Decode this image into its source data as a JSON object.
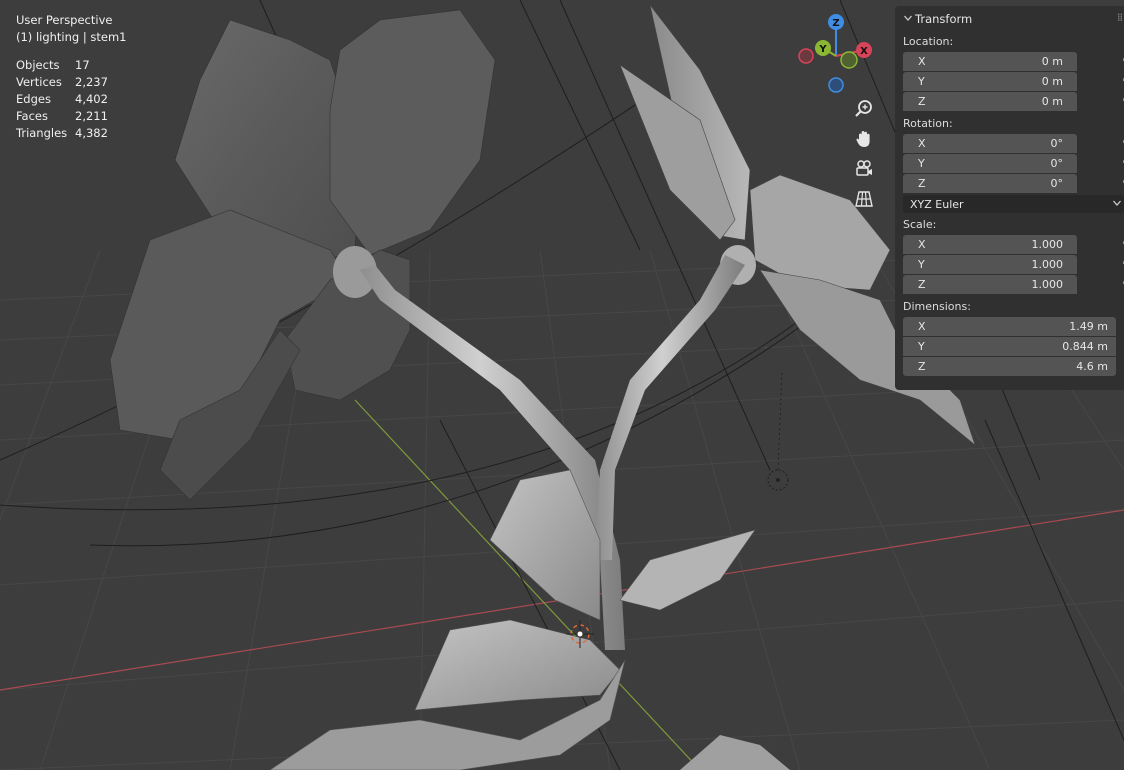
{
  "overlay": {
    "view_name": "User Perspective",
    "collection_object": "(1) lighting | stem1",
    "stats": [
      {
        "label": "Objects",
        "value": "17"
      },
      {
        "label": "Vertices",
        "value": "2,237"
      },
      {
        "label": "Edges",
        "value": "4,402"
      },
      {
        "label": "Faces",
        "value": "2,211"
      },
      {
        "label": "Triangles",
        "value": "4,382"
      }
    ]
  },
  "gizmo": {
    "z": "Z",
    "y": "Y",
    "x": "X"
  },
  "nav_buttons": [
    "zoom-icon",
    "hand-pan-icon",
    "camera-icon",
    "grid-ortho-icon"
  ],
  "panel": {
    "title": "Transform",
    "location": {
      "label": "Location:",
      "fields": [
        {
          "axis": "X",
          "value": "0 m"
        },
        {
          "axis": "Y",
          "value": "0 m"
        },
        {
          "axis": "Z",
          "value": "0 m"
        }
      ]
    },
    "rotation": {
      "label": "Rotation:",
      "fields": [
        {
          "axis": "X",
          "value": "0°"
        },
        {
          "axis": "Y",
          "value": "0°"
        },
        {
          "axis": "Z",
          "value": "0°"
        }
      ],
      "mode": "XYZ Euler"
    },
    "scale": {
      "label": "Scale:",
      "fields": [
        {
          "axis": "X",
          "value": "1.000"
        },
        {
          "axis": "Y",
          "value": "1.000"
        },
        {
          "axis": "Z",
          "value": "1.000"
        }
      ]
    },
    "dimensions": {
      "label": "Dimensions:",
      "fields": [
        {
          "axis": "X",
          "value": "1.49 m"
        },
        {
          "axis": "Y",
          "value": "0.844 m"
        },
        {
          "axis": "Z",
          "value": "4.6 m"
        }
      ]
    }
  },
  "colors": {
    "background": "#3d3d3d",
    "panel": "#303030",
    "field": "#545454",
    "x_axis": "#d9435a",
    "y_axis": "#8bb833",
    "z_axis": "#3f8ee3"
  }
}
